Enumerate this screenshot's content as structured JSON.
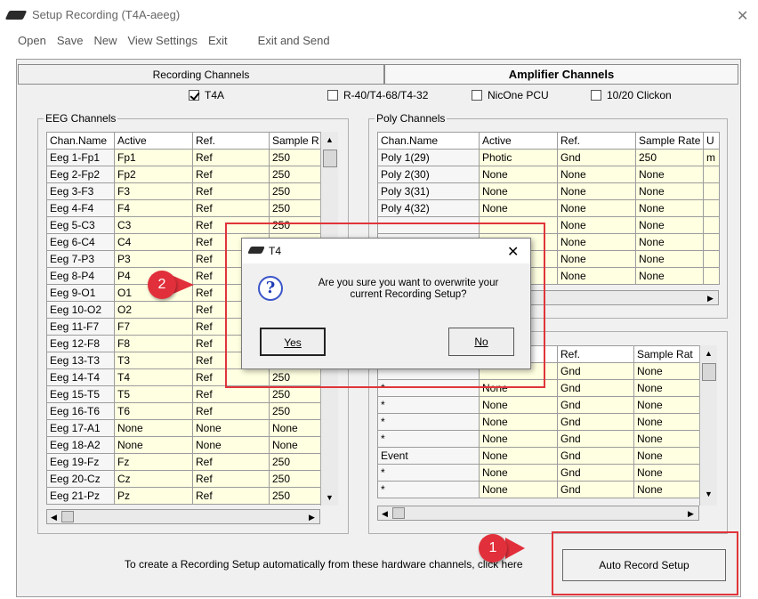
{
  "window": {
    "title": "Setup Recording (T4A-aeeg)",
    "close": "✕"
  },
  "menu": [
    "Open",
    "Save",
    "New",
    "View Settings",
    "Exit",
    "Exit and Send"
  ],
  "tabs": {
    "recording": "Recording Channels",
    "amplifier": "Amplifier Channels"
  },
  "amplifiers": [
    {
      "label": "T4A",
      "checked": true
    },
    {
      "label": "R-40/T4-68/T4-32",
      "checked": false
    },
    {
      "label": "NicOne PCU",
      "checked": false
    },
    {
      "label": "10/20 Clickon",
      "checked": false
    }
  ],
  "eeg": {
    "title": "EEG Channels",
    "headers": [
      "Chan.Name",
      "Active",
      "Ref.",
      "Sample R"
    ],
    "rows": [
      [
        "Eeg 1-Fp1",
        "Fp1",
        "Ref",
        "250"
      ],
      [
        "Eeg 2-Fp2",
        "Fp2",
        "Ref",
        "250"
      ],
      [
        "Eeg 3-F3",
        "F3",
        "Ref",
        "250"
      ],
      [
        "Eeg 4-F4",
        "F4",
        "Ref",
        "250"
      ],
      [
        "Eeg 5-C3",
        "C3",
        "Ref",
        "250"
      ],
      [
        "Eeg 6-C4",
        "C4",
        "Ref",
        ""
      ],
      [
        "Eeg 7-P3",
        "P3",
        "Ref",
        ""
      ],
      [
        "Eeg 8-P4",
        "P4",
        "Ref",
        ""
      ],
      [
        "Eeg 9-O1",
        "O1",
        "Ref",
        ""
      ],
      [
        "Eeg 10-O2",
        "O2",
        "Ref",
        ""
      ],
      [
        "Eeg 11-F7",
        "F7",
        "Ref",
        ""
      ],
      [
        "Eeg 12-F8",
        "F8",
        "Ref",
        ""
      ],
      [
        "Eeg 13-T3",
        "T3",
        "Ref",
        ""
      ],
      [
        "Eeg 14-T4",
        "T4",
        "Ref",
        "250"
      ],
      [
        "Eeg 15-T5",
        "T5",
        "Ref",
        "250"
      ],
      [
        "Eeg 16-T6",
        "T6",
        "Ref",
        "250"
      ],
      [
        "Eeg 17-A1",
        "None",
        "None",
        "None"
      ],
      [
        "Eeg 18-A2",
        "None",
        "None",
        "None"
      ],
      [
        "Eeg 19-Fz",
        "Fz",
        "Ref",
        "250"
      ],
      [
        "Eeg 20-Cz",
        "Cz",
        "Ref",
        "250"
      ],
      [
        "Eeg 21-Pz",
        "Pz",
        "Ref",
        "250"
      ]
    ]
  },
  "poly": {
    "title": "Poly Channels",
    "headers": [
      "Chan.Name",
      "Active",
      "Ref.",
      "Sample Rate",
      "U"
    ],
    "rows": [
      [
        "Poly 1(29)",
        "Photic",
        "Gnd",
        "250",
        "m"
      ],
      [
        "Poly 2(30)",
        "None",
        "None",
        "None",
        ""
      ],
      [
        "Poly 3(31)",
        "None",
        "None",
        "None",
        ""
      ],
      [
        "Poly 4(32)",
        "None",
        "None",
        "None",
        ""
      ],
      [
        "",
        "",
        "None",
        "None",
        ""
      ],
      [
        "",
        "",
        "None",
        "None",
        ""
      ],
      [
        "",
        "",
        "None",
        "None",
        ""
      ],
      [
        "",
        "",
        "None",
        "None",
        ""
      ]
    ]
  },
  "lower": {
    "headers": [
      "",
      "",
      "Ref.",
      "Sample Rat"
    ],
    "rows": [
      [
        "",
        "",
        "Gnd",
        "None"
      ],
      [
        "*",
        "None",
        "Gnd",
        "None"
      ],
      [
        "*",
        "None",
        "Gnd",
        "None"
      ],
      [
        "*",
        "None",
        "Gnd",
        "None"
      ],
      [
        "*",
        "None",
        "Gnd",
        "None"
      ],
      [
        "Event",
        "None",
        "Gnd",
        "None"
      ],
      [
        "*",
        "None",
        "Gnd",
        "None"
      ],
      [
        "*",
        "None",
        "Gnd",
        "None"
      ]
    ]
  },
  "hint": "To create a Recording Setup automatically from these hardware channels, click here",
  "auto_button": "Auto Record Setup",
  "badges": {
    "one": "1",
    "two": "2"
  },
  "dialog": {
    "title": "T4",
    "close": "✕",
    "icon": "question-icon",
    "message_line1": "Are you sure you want to overwrite your",
    "message_line2": "current Recording Setup?",
    "yes": "Yes",
    "no": "No"
  },
  "colors": {
    "annotation_red": "#e0353a",
    "cell_yellow": "#ffffe1"
  }
}
